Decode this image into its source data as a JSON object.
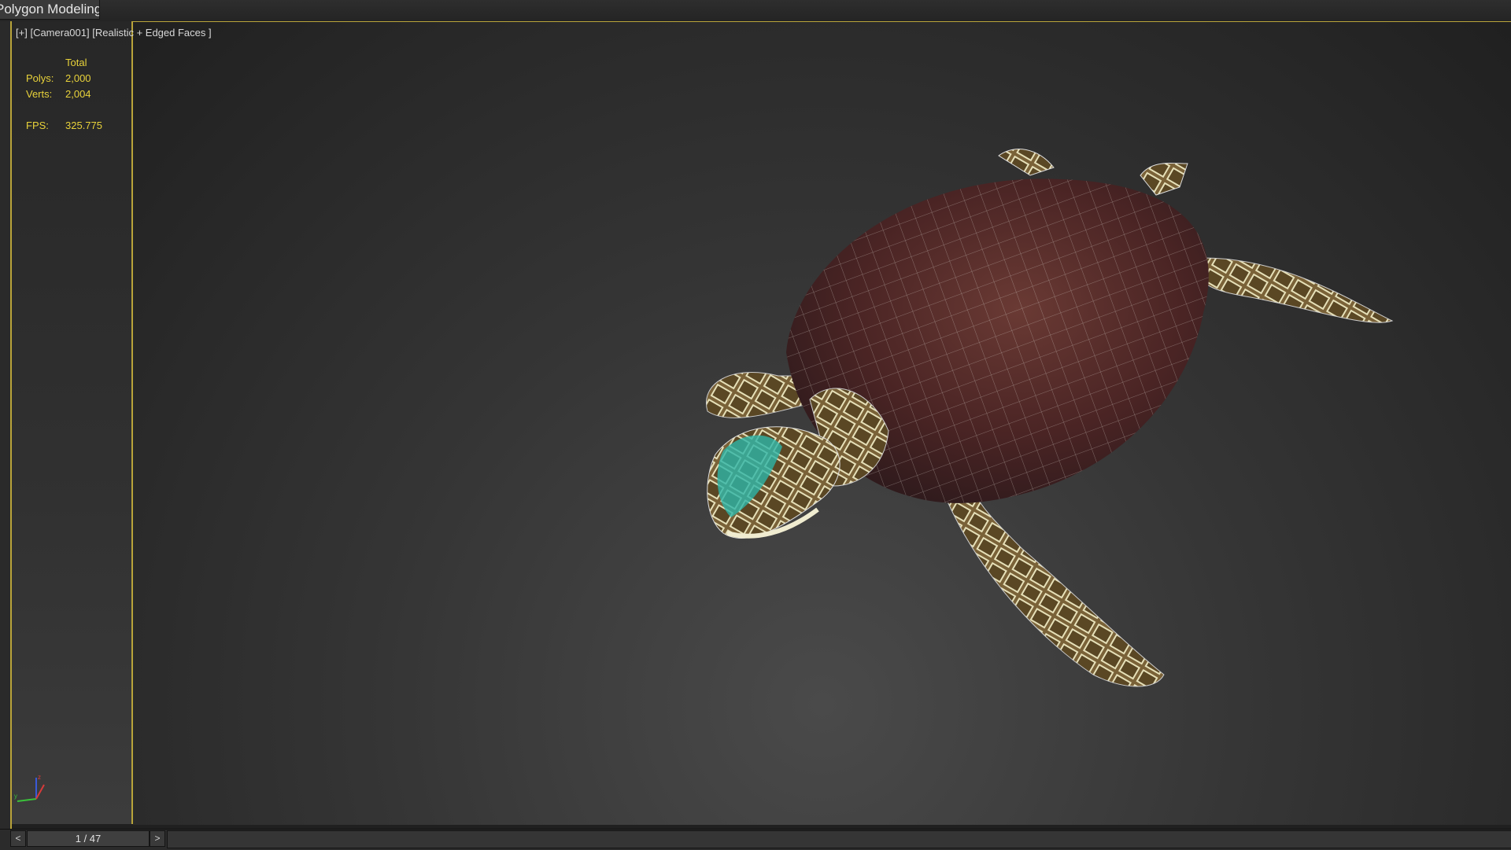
{
  "ribbon": {
    "active_tab_label": "Polygon Modeling"
  },
  "viewport": {
    "label": {
      "menu": "[+]",
      "camera": "[Camera001]",
      "shading": "[Realistic + Edged Faces ]"
    },
    "stats": {
      "header": "Total",
      "polys_label": "Polys:",
      "polys_value": "2,000",
      "verts_label": "Verts:",
      "verts_value": "2,004",
      "fps_label": "FPS:",
      "fps_value": "325.775"
    },
    "axis": {
      "x": "x",
      "y": "y",
      "z": "z"
    }
  },
  "timeline": {
    "prev_label": "<",
    "next_label": ">",
    "frame_counter": "1 / 47"
  },
  "colors": {
    "border_accent": "#b9a43a",
    "stats_text": "#e8d23a"
  }
}
